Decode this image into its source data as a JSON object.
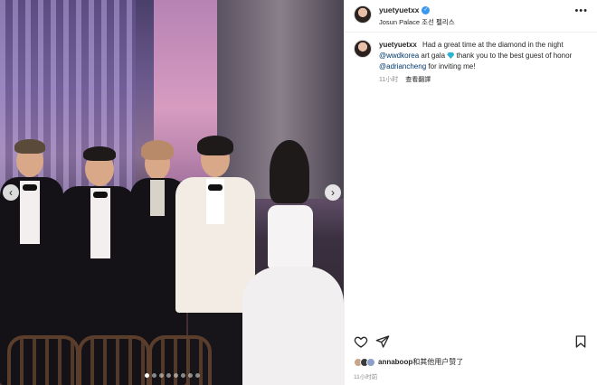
{
  "post": {
    "username": "yuetyuetxx",
    "location": "Josun Palace 조선 펠리스",
    "caption": {
      "username": "yuetyuetxx",
      "text_1": "Had a great time at the diamond in the night",
      "mention_1": "@wwdkorea",
      "text_2": "art gala",
      "text_3": "thank you to the best guest of honor",
      "mention_2": "@adriancheng",
      "text_4": "for inviting me!"
    },
    "caption_time": "11小时",
    "translate_label": "查看翻譯",
    "likes": {
      "username": "annaboop",
      "suffix": "和其他用户赞了"
    },
    "post_time": "11小时前"
  },
  "carousel": {
    "count": 8,
    "active_index": 1
  },
  "icons": {
    "more": "more-horizontal-icon",
    "heart": "heart-icon",
    "share": "share-icon",
    "bookmark": "bookmark-icon",
    "prev": "chevron-left-icon",
    "next": "chevron-right-icon"
  },
  "colors": {
    "link": "#00376b",
    "verified": "#3897f0",
    "muted": "#8e8e8e"
  }
}
